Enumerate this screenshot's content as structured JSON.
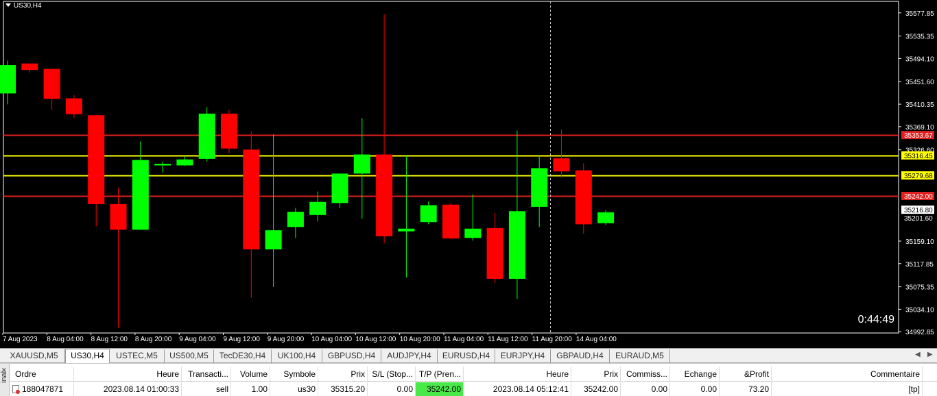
{
  "chart": {
    "title": "US30,H4",
    "timer": "0:44:49",
    "colors": {
      "bull": "#00ff00",
      "bear": "#ff0000",
      "background": "#000000",
      "grid_text": "#ffffff",
      "sl_tp_line": "#e02020",
      "entry_line": "#ffff00"
    }
  },
  "chart_data": {
    "type": "candlestick",
    "title": "US30,H4",
    "y_ticks": [
      "35577.85",
      "35535.35",
      "35494.10",
      "35451.60",
      "35410.35",
      "35369.10",
      "35326.60",
      "35159.10",
      "35117.85",
      "35075.35",
      "35034.10",
      "34992.85"
    ],
    "x_ticks": [
      "7 Aug 2023",
      "8 Aug 04:00",
      "8 Aug 12:00",
      "8 Aug 20:00",
      "9 Aug 04:00",
      "9 Aug 12:00",
      "9 Aug 20:00",
      "10 Aug 04:00",
      "10 Aug 12:00",
      "10 Aug 20:00",
      "11 Aug 04:00",
      "11 Aug 12:00",
      "11 Aug 20:00",
      "14 Aug 04:00"
    ],
    "price_labels": [
      {
        "value": "35353.67",
        "color": "#e02020"
      },
      {
        "value": "35316.45",
        "color": "#ffff00"
      },
      {
        "value": "35279.68",
        "color": "#ffff00"
      },
      {
        "value": "35242.00",
        "color": "#e02020"
      },
      {
        "value": "35216.80",
        "color": "#ffffff"
      },
      {
        "value": "35201.60",
        "color": "none"
      }
    ],
    "horizontal_lines": [
      {
        "value": 35353.67,
        "color": "#e02020"
      },
      {
        "value": 35316.45,
        "color": "#ffff00"
      },
      {
        "value": 35279.68,
        "color": "#ffff00"
      },
      {
        "value": 35242.0,
        "color": "#e02020"
      }
    ],
    "crosshair_time_index": 24.5,
    "candles": [
      {
        "o": 35430,
        "h": 35490,
        "l": 35410,
        "c": 35482
      },
      {
        "o": 35485,
        "h": 35485,
        "l": 35468,
        "c": 35473
      },
      {
        "o": 35475,
        "h": 35475,
        "l": 35400,
        "c": 35420
      },
      {
        "o": 35421,
        "h": 35427,
        "l": 35385,
        "c": 35392
      },
      {
        "o": 35390,
        "h": 35390,
        "l": 35186,
        "c": 35227
      },
      {
        "o": 35227,
        "h": 35257,
        "l": 35000,
        "c": 35180
      },
      {
        "o": 35180,
        "h": 35342,
        "l": 35180,
        "c": 35308
      },
      {
        "o": 35298,
        "h": 35305,
        "l": 35285,
        "c": 35301
      },
      {
        "o": 35298,
        "h": 35315,
        "l": 35297,
        "c": 35309
      },
      {
        "o": 35310,
        "h": 35405,
        "l": 35305,
        "c": 35393
      },
      {
        "o": 35393,
        "h": 35400,
        "l": 35320,
        "c": 35329
      },
      {
        "o": 35327,
        "h": 35360,
        "l": 35055,
        "c": 35144
      },
      {
        "o": 35144,
        "h": 35355,
        "l": 35075,
        "c": 35179
      },
      {
        "o": 35185,
        "h": 35220,
        "l": 35165,
        "c": 35213
      },
      {
        "o": 35207,
        "h": 35250,
        "l": 35195,
        "c": 35231
      },
      {
        "o": 35229,
        "h": 35281,
        "l": 35220,
        "c": 35283
      },
      {
        "o": 35283,
        "h": 35385,
        "l": 35200,
        "c": 35318
      },
      {
        "o": 35318,
        "h": 35575,
        "l": 35155,
        "c": 35168
      },
      {
        "o": 35177,
        "h": 35316,
        "l": 35092,
        "c": 35182
      },
      {
        "o": 35194,
        "h": 35232,
        "l": 35190,
        "c": 35225
      },
      {
        "o": 35226,
        "h": 35229,
        "l": 35163,
        "c": 35164
      },
      {
        "o": 35165,
        "h": 35245,
        "l": 35160,
        "c": 35182
      },
      {
        "o": 35183,
        "h": 35211,
        "l": 35082,
        "c": 35090
      },
      {
        "o": 35090,
        "h": 35362,
        "l": 35053,
        "c": 35214
      },
      {
        "o": 35222,
        "h": 35317,
        "l": 35185,
        "c": 35293
      },
      {
        "o": 35311,
        "h": 35364,
        "l": 35275,
        "c": 35287
      },
      {
        "o": 35289,
        "h": 35302,
        "l": 35173,
        "c": 35190
      },
      {
        "o": 35192,
        "h": 35216,
        "l": 35189,
        "c": 35212
      }
    ]
  },
  "tabs": [
    "XAUUSD,M5",
    "US30,H4",
    "USTEC,M5",
    "US500,M5",
    "TecDE30,H4",
    "UK100,H4",
    "GBPUSD,H4",
    "AUDJPY,H4",
    "EURUSD,H4",
    "EURJPY,H4",
    "GBPAUD,H4",
    "EURAUD,M5"
  ],
  "active_tab": "US30,H4",
  "terminal": {
    "side_label": "inal",
    "headers": [
      "Ordre",
      "Heure",
      "Transacti...",
      "Volume",
      "Symbole",
      "Prix",
      "S/L (Stop...",
      "T/P (Pren...",
      "Heure",
      "Prix",
      "Commiss...",
      "Echange",
      "&Profit",
      "Commentaire"
    ],
    "row": [
      "188047871",
      "2023.08.14 01:00:33",
      "sell",
      "1.00",
      "us30",
      "35315.20",
      "0.00",
      "35242.00",
      "2023.08.14 05:12:41",
      "35242.00",
      "0.00",
      "0.00",
      "73.20",
      "[tp]"
    ]
  }
}
